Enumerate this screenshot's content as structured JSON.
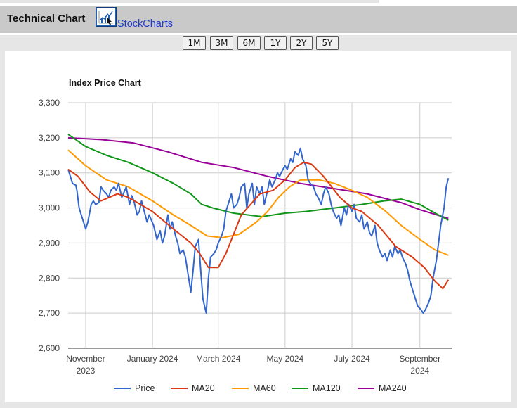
{
  "header": {
    "title": "Technical Chart",
    "logo_icon": "stockcharts-logo-icon",
    "logo_text": "StockCharts"
  },
  "ranges": [
    "1M",
    "3M",
    "6M",
    "1Y",
    "2Y",
    "5Y"
  ],
  "colors": {
    "header_bg": "#c9c9c9",
    "price": "#3366cc",
    "ma20": "#dc3912",
    "ma60": "#ff9900",
    "ma120": "#109618",
    "ma240": "#990099",
    "link": "#1d3cc8"
  },
  "chart_data": {
    "type": "line",
    "title": "Index Price Chart",
    "x_start": "2023-10-16",
    "x_end": "2024-09-30",
    "x_ticks": [
      {
        "date": "2023-11-01",
        "label": "November",
        "label2": "2023"
      },
      {
        "date": "2024-01-01",
        "label": "January 2024",
        "label2": ""
      },
      {
        "date": "2024-03-01",
        "label": "March 2024",
        "label2": ""
      },
      {
        "date": "2024-05-01",
        "label": "May 2024",
        "label2": ""
      },
      {
        "date": "2024-07-01",
        "label": "July 2024",
        "label2": ""
      },
      {
        "date": "2024-09-01",
        "label": "September",
        "label2": "2024"
      }
    ],
    "ylim": [
      2600,
      3300
    ],
    "y_ticks": [
      2600,
      2700,
      2800,
      2900,
      3000,
      3100,
      3200,
      3300
    ],
    "y_tick_labels": [
      "2,600",
      "2,700",
      "2,800",
      "2,900",
      "3,000",
      "3,100",
      "3,200",
      "3,300"
    ],
    "grid": true,
    "legend_position": "bottom",
    "series": [
      {
        "name": "Price",
        "color": "#3366cc",
        "points": [
          [
            "2023-10-16",
            3110
          ],
          [
            "2023-10-18",
            3090
          ],
          [
            "2023-10-20",
            3070
          ],
          [
            "2023-10-23",
            3065
          ],
          [
            "2023-10-24",
            3050
          ],
          [
            "2023-10-26",
            3000
          ],
          [
            "2023-10-28",
            2980
          ],
          [
            "2023-10-31",
            2950
          ],
          [
            "2023-11-01",
            2940
          ],
          [
            "2023-11-03",
            2960
          ],
          [
            "2023-11-06",
            3010
          ],
          [
            "2023-11-08",
            3020
          ],
          [
            "2023-11-10",
            3010
          ],
          [
            "2023-11-13",
            3015
          ],
          [
            "2023-11-15",
            3060
          ],
          [
            "2023-11-17",
            3050
          ],
          [
            "2023-11-20",
            3040
          ],
          [
            "2023-11-22",
            3030
          ],
          [
            "2023-11-24",
            3050
          ],
          [
            "2023-11-27",
            3060
          ],
          [
            "2023-11-29",
            3050
          ],
          [
            "2023-12-01",
            3070
          ],
          [
            "2023-12-04",
            3030
          ],
          [
            "2023-12-06",
            3045
          ],
          [
            "2023-12-08",
            3060
          ],
          [
            "2023-12-11",
            3010
          ],
          [
            "2023-12-13",
            3035
          ],
          [
            "2023-12-15",
            3020
          ],
          [
            "2023-12-18",
            2980
          ],
          [
            "2023-12-20",
            2990
          ],
          [
            "2023-12-22",
            3020
          ],
          [
            "2023-12-27",
            2960
          ],
          [
            "2023-12-29",
            2980
          ],
          [
            "2024-01-02",
            2950
          ],
          [
            "2024-01-05",
            2910
          ],
          [
            "2024-01-08",
            2935
          ],
          [
            "2024-01-10",
            2900
          ],
          [
            "2024-01-12",
            2920
          ],
          [
            "2024-01-15",
            2980
          ],
          [
            "2024-01-17",
            2940
          ],
          [
            "2024-01-19",
            2960
          ],
          [
            "2024-01-22",
            2920
          ],
          [
            "2024-01-24",
            2900
          ],
          [
            "2024-01-26",
            2870
          ],
          [
            "2024-01-29",
            2880
          ],
          [
            "2024-01-31",
            2860
          ],
          [
            "2024-02-02",
            2820
          ],
          [
            "2024-02-05",
            2760
          ],
          [
            "2024-02-07",
            2820
          ],
          [
            "2024-02-09",
            2890
          ],
          [
            "2024-02-12",
            2910
          ],
          [
            "2024-02-14",
            2820
          ],
          [
            "2024-02-16",
            2740
          ],
          [
            "2024-02-19",
            2700
          ],
          [
            "2024-02-21",
            2800
          ],
          [
            "2024-02-23",
            2860
          ],
          [
            "2024-02-26",
            2870
          ],
          [
            "2024-02-28",
            2880
          ],
          [
            "2024-03-01",
            2900
          ],
          [
            "2024-03-04",
            2920
          ],
          [
            "2024-03-06",
            2940
          ],
          [
            "2024-03-08",
            2990
          ],
          [
            "2024-03-11",
            3020
          ],
          [
            "2024-03-13",
            3040
          ],
          [
            "2024-03-15",
            3000
          ],
          [
            "2024-03-18",
            3010
          ],
          [
            "2024-03-20",
            3030
          ],
          [
            "2024-03-22",
            3060
          ],
          [
            "2024-03-25",
            3070
          ],
          [
            "2024-03-27",
            3000
          ],
          [
            "2024-03-29",
            3040
          ],
          [
            "2024-04-01",
            3070
          ],
          [
            "2024-04-03",
            3010
          ],
          [
            "2024-04-05",
            3060
          ],
          [
            "2024-04-08",
            3040
          ],
          [
            "2024-04-10",
            3060
          ],
          [
            "2024-04-12",
            3010
          ],
          [
            "2024-04-15",
            3050
          ],
          [
            "2024-04-17",
            3080
          ],
          [
            "2024-04-19",
            3060
          ],
          [
            "2024-04-22",
            3080
          ],
          [
            "2024-04-24",
            3100
          ],
          [
            "2024-04-26",
            3090
          ],
          [
            "2024-04-29",
            3110
          ],
          [
            "2024-05-01",
            3120
          ],
          [
            "2024-05-03",
            3110
          ],
          [
            "2024-05-06",
            3140
          ],
          [
            "2024-05-08",
            3130
          ],
          [
            "2024-05-10",
            3160
          ],
          [
            "2024-05-13",
            3150
          ],
          [
            "2024-05-15",
            3170
          ],
          [
            "2024-05-17",
            3140
          ],
          [
            "2024-05-20",
            3120
          ],
          [
            "2024-05-22",
            3080
          ],
          [
            "2024-05-24",
            3070
          ],
          [
            "2024-05-27",
            3060
          ],
          [
            "2024-05-29",
            3040
          ],
          [
            "2024-05-31",
            3030
          ],
          [
            "2024-06-03",
            3010
          ],
          [
            "2024-06-05",
            3040
          ],
          [
            "2024-06-07",
            3060
          ],
          [
            "2024-06-10",
            3040
          ],
          [
            "2024-06-12",
            3010
          ],
          [
            "2024-06-14",
            2990
          ],
          [
            "2024-06-17",
            2970
          ],
          [
            "2024-06-19",
            2980
          ],
          [
            "2024-06-21",
            2950
          ],
          [
            "2024-06-24",
            3000
          ],
          [
            "2024-06-26",
            2980
          ],
          [
            "2024-06-28",
            3010
          ],
          [
            "2024-07-01",
            2990
          ],
          [
            "2024-07-03",
            3010
          ],
          [
            "2024-07-05",
            2970
          ],
          [
            "2024-07-08",
            2960
          ],
          [
            "2024-07-10",
            2980
          ],
          [
            "2024-07-12",
            2940
          ],
          [
            "2024-07-15",
            2960
          ],
          [
            "2024-07-17",
            2930
          ],
          [
            "2024-07-19",
            2920
          ],
          [
            "2024-07-22",
            2950
          ],
          [
            "2024-07-24",
            2900
          ],
          [
            "2024-07-26",
            2880
          ],
          [
            "2024-07-29",
            2860
          ],
          [
            "2024-07-31",
            2870
          ],
          [
            "2024-08-02",
            2850
          ],
          [
            "2024-08-05",
            2880
          ],
          [
            "2024-08-07",
            2860
          ],
          [
            "2024-08-09",
            2890
          ],
          [
            "2024-08-12",
            2870
          ],
          [
            "2024-08-14",
            2880
          ],
          [
            "2024-08-16",
            2860
          ],
          [
            "2024-08-19",
            2840
          ],
          [
            "2024-08-21",
            2820
          ],
          [
            "2024-08-23",
            2790
          ],
          [
            "2024-08-26",
            2760
          ],
          [
            "2024-08-28",
            2740
          ],
          [
            "2024-08-30",
            2720
          ],
          [
            "2024-09-02",
            2710
          ],
          [
            "2024-09-04",
            2700
          ],
          [
            "2024-09-06",
            2710
          ],
          [
            "2024-09-09",
            2730
          ],
          [
            "2024-09-11",
            2750
          ],
          [
            "2024-09-13",
            2800
          ],
          [
            "2024-09-16",
            2850
          ],
          [
            "2024-09-18",
            2900
          ],
          [
            "2024-09-20",
            2950
          ],
          [
            "2024-09-23",
            3000
          ],
          [
            "2024-09-25",
            3060
          ],
          [
            "2024-09-27",
            3085
          ]
        ]
      },
      {
        "name": "MA20",
        "color": "#dc3912",
        "points": [
          [
            "2023-10-16",
            3110
          ],
          [
            "2023-10-25",
            3090
          ],
          [
            "2023-11-05",
            3045
          ],
          [
            "2023-11-15",
            3020
          ],
          [
            "2023-11-30",
            3040
          ],
          [
            "2023-12-10",
            3030
          ],
          [
            "2024-01-01",
            2990
          ],
          [
            "2024-01-20",
            2940
          ],
          [
            "2024-02-05",
            2900
          ],
          [
            "2024-02-13",
            2870
          ],
          [
            "2024-02-21",
            2830
          ],
          [
            "2024-03-01",
            2830
          ],
          [
            "2024-03-08",
            2870
          ],
          [
            "2024-03-22",
            2980
          ],
          [
            "2024-04-08",
            3040
          ],
          [
            "2024-04-20",
            3050
          ],
          [
            "2024-05-01",
            3080
          ],
          [
            "2024-05-10",
            3115
          ],
          [
            "2024-05-18",
            3130
          ],
          [
            "2024-05-25",
            3125
          ],
          [
            "2024-06-05",
            3090
          ],
          [
            "2024-06-20",
            3030
          ],
          [
            "2024-07-01",
            3000
          ],
          [
            "2024-07-10",
            2990
          ],
          [
            "2024-07-25",
            2950
          ],
          [
            "2024-08-10",
            2890
          ],
          [
            "2024-08-25",
            2860
          ],
          [
            "2024-09-05",
            2830
          ],
          [
            "2024-09-15",
            2790
          ],
          [
            "2024-09-22",
            2770
          ],
          [
            "2024-09-27",
            2795
          ]
        ]
      },
      {
        "name": "MA60",
        "color": "#ff9900",
        "points": [
          [
            "2023-10-16",
            3165
          ],
          [
            "2023-11-01",
            3120
          ],
          [
            "2023-11-20",
            3080
          ],
          [
            "2023-12-10",
            3060
          ],
          [
            "2024-01-01",
            3020
          ],
          [
            "2024-01-20",
            2980
          ],
          [
            "2024-02-05",
            2950
          ],
          [
            "2024-02-20",
            2920
          ],
          [
            "2024-03-05",
            2915
          ],
          [
            "2024-03-20",
            2925
          ],
          [
            "2024-04-05",
            2960
          ],
          [
            "2024-04-15",
            2990
          ],
          [
            "2024-04-25",
            3030
          ],
          [
            "2024-05-05",
            3060
          ],
          [
            "2024-05-15",
            3080
          ],
          [
            "2024-06-01",
            3080
          ],
          [
            "2024-06-15",
            3070
          ],
          [
            "2024-07-01",
            3050
          ],
          [
            "2024-07-15",
            3030
          ],
          [
            "2024-08-01",
            2990
          ],
          [
            "2024-08-15",
            2950
          ],
          [
            "2024-09-01",
            2910
          ],
          [
            "2024-09-15",
            2880
          ],
          [
            "2024-09-27",
            2865
          ]
        ]
      },
      {
        "name": "MA120",
        "color": "#109618",
        "points": [
          [
            "2023-10-16",
            3210
          ],
          [
            "2023-11-01",
            3175
          ],
          [
            "2023-11-20",
            3150
          ],
          [
            "2023-12-10",
            3130
          ],
          [
            "2024-01-01",
            3100
          ],
          [
            "2024-01-20",
            3070
          ],
          [
            "2024-02-05",
            3040
          ],
          [
            "2024-02-15",
            3010
          ],
          [
            "2024-02-25",
            3000
          ],
          [
            "2024-03-15",
            2985
          ],
          [
            "2024-04-10",
            2975
          ],
          [
            "2024-05-01",
            2985
          ],
          [
            "2024-05-20",
            2990
          ],
          [
            "2024-06-15",
            3000
          ],
          [
            "2024-07-10",
            3010
          ],
          [
            "2024-07-30",
            3020
          ],
          [
            "2024-08-15",
            3025
          ],
          [
            "2024-09-01",
            3010
          ],
          [
            "2024-09-15",
            2985
          ],
          [
            "2024-09-27",
            2965
          ]
        ]
      },
      {
        "name": "MA240",
        "color": "#990099",
        "points": [
          [
            "2023-10-16",
            3200
          ],
          [
            "2023-11-15",
            3195
          ],
          [
            "2023-12-15",
            3185
          ],
          [
            "2024-01-15",
            3160
          ],
          [
            "2024-02-15",
            3130
          ],
          [
            "2024-03-15",
            3115
          ],
          [
            "2024-04-15",
            3090
          ],
          [
            "2024-05-15",
            3070
          ],
          [
            "2024-06-15",
            3055
          ],
          [
            "2024-07-15",
            3040
          ],
          [
            "2024-08-15",
            3015
          ],
          [
            "2024-09-01",
            2995
          ],
          [
            "2024-09-27",
            2970
          ]
        ]
      }
    ]
  }
}
